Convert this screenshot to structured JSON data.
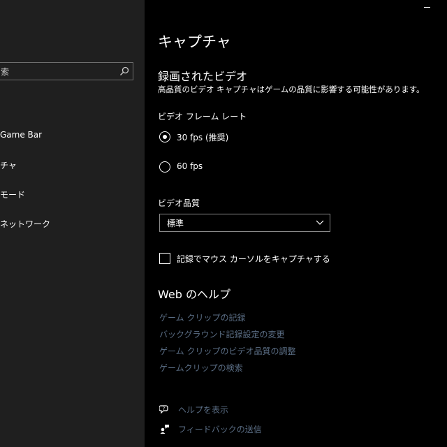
{
  "window": {
    "minimize_label": "minimize"
  },
  "sidebar": {
    "search_placeholder": "索",
    "items": [
      {
        "label": "Game Bar"
      },
      {
        "label": "チャ"
      },
      {
        "label": "モード"
      },
      {
        "label": "ネットワーク"
      }
    ]
  },
  "main": {
    "page_title": "キャプチャ",
    "recorded_video": {
      "title": "録画されたビデオ",
      "description": "高品質のビデオ キャプチャはゲームの品質に影響する可能性があります。"
    },
    "frame_rate": {
      "label": "ビデオ フレーム レート",
      "options": [
        {
          "label": "30 fps (推奨)",
          "selected": true
        },
        {
          "label": "60 fps",
          "selected": false
        }
      ]
    },
    "video_quality": {
      "label": "ビデオ品質",
      "selected": "標準"
    },
    "capture_cursor": {
      "label": "記録でマウス カーソルをキャプチャする",
      "checked": false
    },
    "web_help": {
      "title": "Web のヘルプ",
      "links": [
        "ゲーム クリップの記録",
        "バックグラウンド記録設定の変更",
        "ゲーム クリップのビデオ品質の調整",
        "ゲームクリップの検索"
      ]
    },
    "bottom_links": {
      "help": "ヘルプを表示",
      "feedback": "フィードバックの送信"
    }
  },
  "colors": {
    "sidebar_bg": "#1f1f1f",
    "main_bg": "#000000",
    "link": "#5a6d84",
    "text": "#ffffff"
  }
}
